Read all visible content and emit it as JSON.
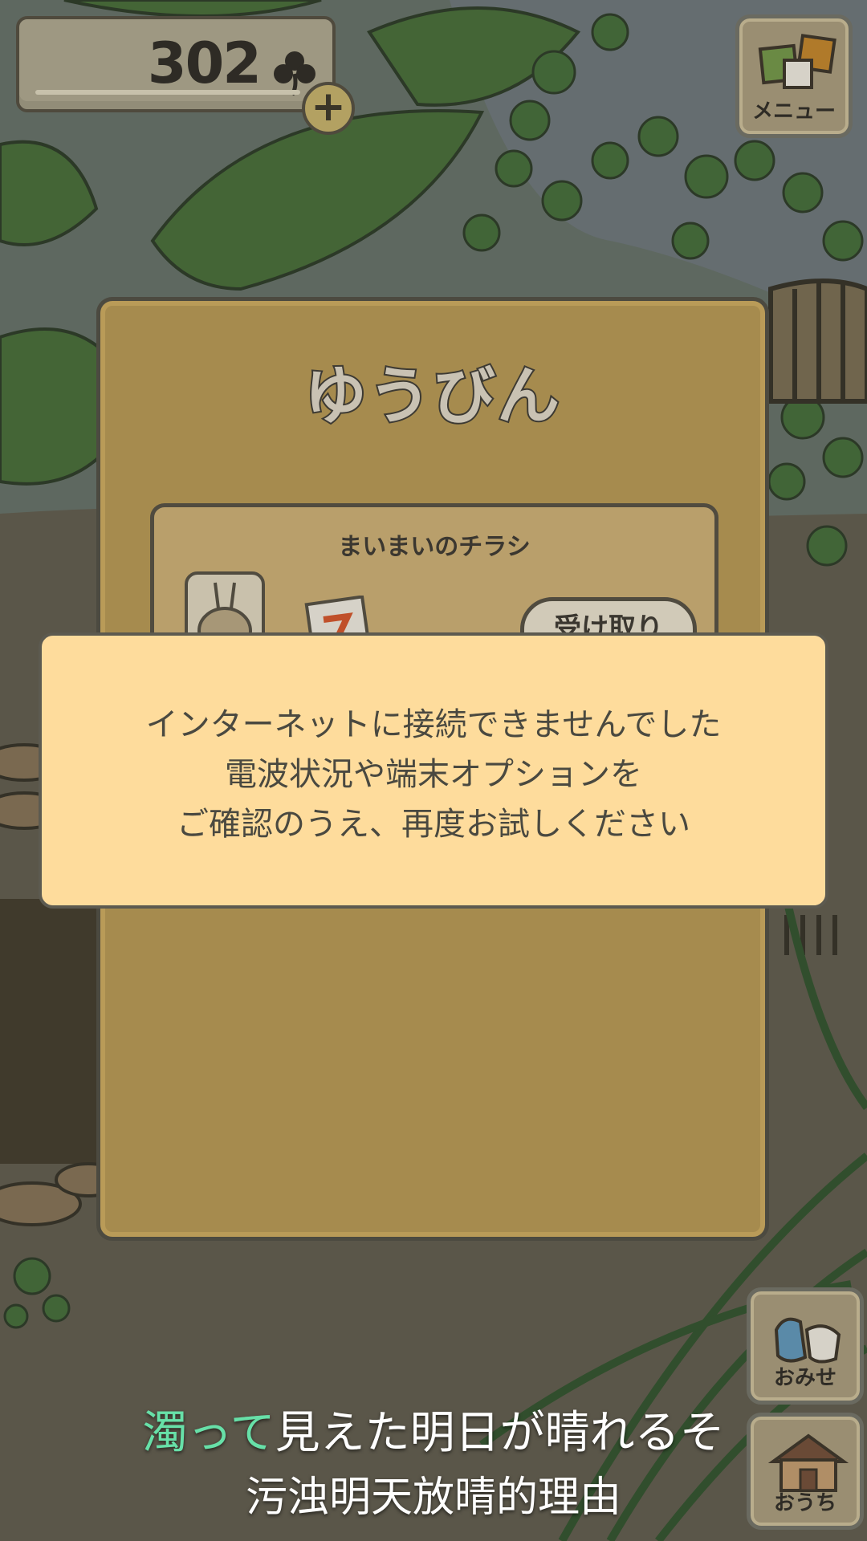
{
  "header": {
    "clover_count": "302",
    "clover_icon": "clover-icon",
    "add_icon": "plus-icon"
  },
  "menu": {
    "label": "メニュー"
  },
  "mail_panel": {
    "title": "ゆうびん",
    "item": {
      "title": "まいまいのチラシ",
      "receive_label": "受け取り"
    }
  },
  "alert": {
    "lines": [
      "インターネットに接続できませんでした",
      "電波状況や端末オプションを",
      "ご確認のうえ、再度お試しください"
    ]
  },
  "side_buttons": {
    "shop_label": "おみせ",
    "home_label": "おうち"
  },
  "subtitles": {
    "jp_highlight": "濁って",
    "jp_rest": "見えた明日が晴れるそ",
    "cn": "污浊明天放晴的理由"
  },
  "colors": {
    "panel": "#a68b4e",
    "alert_bg": "#fedc9c",
    "subtitle_highlight": "#67e0a8"
  }
}
